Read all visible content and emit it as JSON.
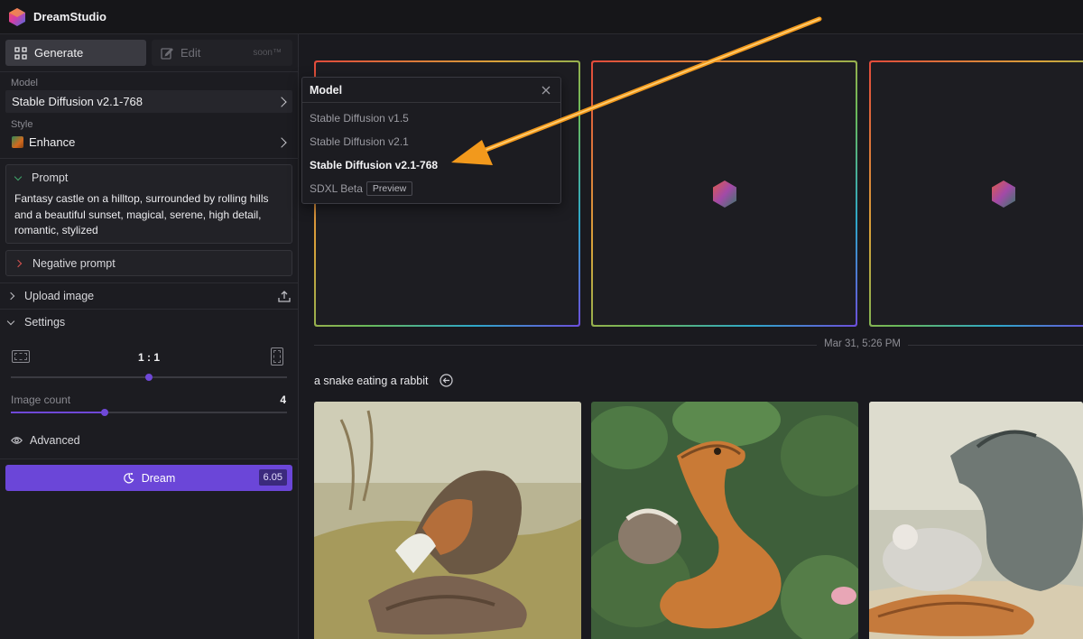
{
  "app": {
    "title": "DreamStudio"
  },
  "sidebar": {
    "tabs": [
      {
        "label": "Generate"
      },
      {
        "label": "Edit",
        "badge": "soon™"
      }
    ],
    "model": {
      "label": "Model",
      "value": "Stable Diffusion v2.1-768"
    },
    "style": {
      "label": "Style",
      "value": "Enhance"
    },
    "prompt": {
      "label": "Prompt",
      "text": "Fantasy castle on a hilltop, surrounded by rolling hills and a beautiful sunset, magical, serene, high detail, romantic, stylized"
    },
    "negative_prompt": {
      "label": "Negative prompt"
    },
    "upload_image": {
      "label": "Upload image"
    },
    "settings": {
      "label": "Settings",
      "aspect_ratio": "1 : 1",
      "aspect_slider_fraction": 0.5,
      "image_count_label": "Image count",
      "image_count": "4",
      "image_count_fraction": 0.34,
      "advanced_label": "Advanced"
    },
    "dream_button": {
      "label": "Dream",
      "cost": "6.05"
    }
  },
  "dropdown": {
    "title": "Model",
    "items": [
      {
        "label": "Stable Diffusion v1.5",
        "selected": false
      },
      {
        "label": "Stable Diffusion v2.1",
        "selected": false
      },
      {
        "label": "Stable Diffusion v2.1-768",
        "selected": true
      },
      {
        "label": "SDXL Beta",
        "badge": "Preview",
        "selected": false
      }
    ]
  },
  "main": {
    "history_date": "Mar 31, 5:26 PM",
    "generation_title": "a snake eating a rabbit"
  },
  "colors": {
    "accent": "#6b46d8",
    "annotation_arrow": "#f2991c"
  }
}
